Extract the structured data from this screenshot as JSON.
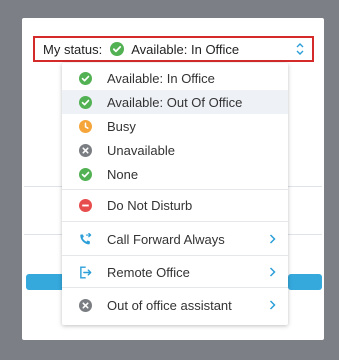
{
  "status": {
    "label": "My status:",
    "value": "Available: In Office"
  },
  "menu": {
    "items": [
      {
        "label": "Available: In Office",
        "icon": "check-circle-icon",
        "color": "#52b153"
      },
      {
        "label": "Available: Out Of Office",
        "icon": "check-circle-icon",
        "color": "#52b153"
      },
      {
        "label": "Busy",
        "icon": "clock-icon",
        "color": "#f5a53a"
      },
      {
        "label": "Unavailable",
        "icon": "x-circle-icon",
        "color": "#7a7d82"
      },
      {
        "label": "None",
        "icon": "check-circle-icon",
        "color": "#52b153"
      },
      {
        "label": "Do Not Disturb",
        "icon": "minus-circle-icon",
        "color": "#e84d4d"
      },
      {
        "label": "Call Forward Always",
        "icon": "phone-forward-icon",
        "color": "#2d9fd8"
      },
      {
        "label": "Remote Office",
        "icon": "remote-office-icon",
        "color": "#2d9fd8"
      },
      {
        "label": "Out of office assistant",
        "icon": "x-circle-icon",
        "color": "#7a7d82"
      }
    ]
  }
}
